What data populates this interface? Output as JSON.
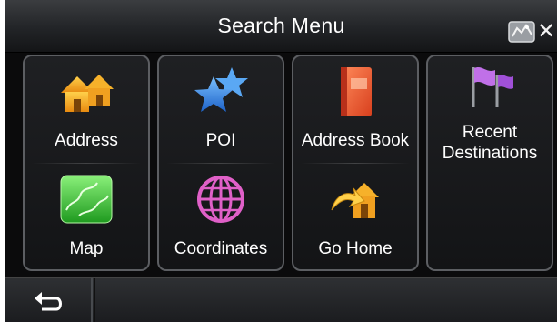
{
  "header": {
    "title": "Search Menu",
    "map_icon": "map-icon",
    "close_icon": "close-icon",
    "close_glyph": "✕"
  },
  "menu": {
    "items": [
      {
        "label": "Address",
        "icon": "house-icon"
      },
      {
        "label": "POI",
        "icon": "star-icon"
      },
      {
        "label": "Address Book",
        "icon": "book-icon"
      },
      {
        "label": "Recent Destinations",
        "icon": "flag-icon"
      },
      {
        "label": "Map",
        "icon": "map-icon"
      },
      {
        "label": "Coordinates",
        "icon": "globe-icon"
      },
      {
        "label": "Go Home",
        "icon": "go-home-icon"
      }
    ]
  },
  "footer": {
    "back_icon": "back-arrow-icon"
  },
  "colors": {
    "background": "#0b0b0c",
    "tile_border": "#5c5e62",
    "text": "#ffffff",
    "house": "#f4a21c",
    "star": "#3a8fe8",
    "book": "#e8553a",
    "flag": "#b060d8",
    "map": "#3cc43c",
    "globe": "#d050b0"
  }
}
